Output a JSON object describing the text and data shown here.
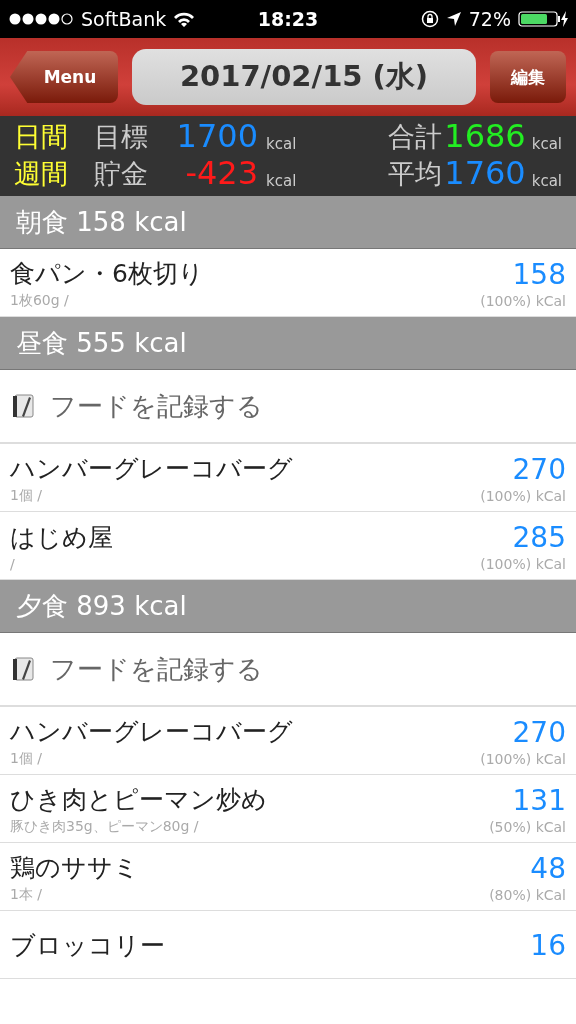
{
  "status_bar": {
    "carrier": "SoftBank",
    "time": "18:23",
    "battery": "72%"
  },
  "nav": {
    "back": "Menu",
    "date": "2017/02/15 (水)",
    "edit": "編集"
  },
  "summary": {
    "rows": [
      {
        "period": "日間",
        "cells": [
          {
            "label": "目標",
            "value": "1700",
            "color": "#1a8cff",
            "unit": "kcal"
          },
          {
            "label": "合計",
            "value": "1686",
            "color": "#22ee22",
            "unit": "kcal"
          }
        ]
      },
      {
        "period": "週間",
        "cells": [
          {
            "label": "貯金",
            "value": "-423",
            "color": "#ff1a1a",
            "unit": "kcal"
          },
          {
            "label": "平均",
            "value": "1760",
            "color": "#1a8cff",
            "unit": "kcal"
          }
        ]
      }
    ]
  },
  "meals": [
    {
      "title": "朝食 158 kcal",
      "items": [
        {
          "kind": "food",
          "name": "食パン・6枚切り",
          "portion": "1枚60g /",
          "kcal": "158",
          "ratio": "(100%) kCal"
        }
      ]
    },
    {
      "title": "昼食 555 kcal",
      "items": [
        {
          "kind": "add",
          "label": "フードを記録する"
        },
        {
          "kind": "food",
          "name": "ハンバーグレーコバーグ",
          "portion": "1個 /",
          "kcal": "270",
          "ratio": "(100%) kCal"
        },
        {
          "kind": "food",
          "name": "はじめ屋",
          "portion": "/",
          "kcal": "285",
          "ratio": "(100%) kCal"
        }
      ]
    },
    {
      "title": "夕食 893 kcal",
      "items": [
        {
          "kind": "add",
          "label": "フードを記録する"
        },
        {
          "kind": "food",
          "name": "ハンバーグレーコバーグ",
          "portion": "1個 /",
          "kcal": "270",
          "ratio": "(100%) kCal"
        },
        {
          "kind": "food",
          "name": "ひき肉とピーマン炒め",
          "portion": "豚ひき肉35g、ピーマン80g /",
          "kcal": "131",
          "ratio": "(50%) kCal"
        },
        {
          "kind": "food",
          "name": "鶏のササミ",
          "portion": "1本 /",
          "kcal": "48",
          "ratio": "(80%) kCal"
        },
        {
          "kind": "food",
          "name": "ブロッコリー",
          "kcal": "16"
        }
      ]
    }
  ]
}
